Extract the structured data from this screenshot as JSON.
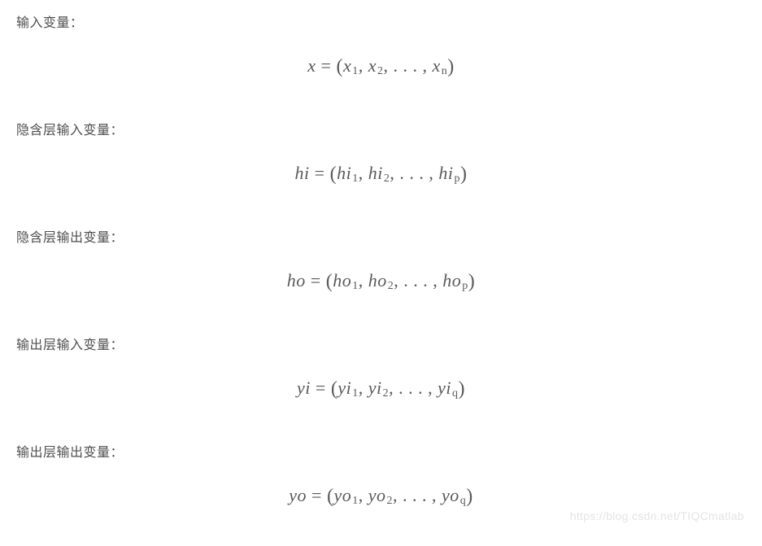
{
  "sections": [
    {
      "label": "输入变量：",
      "lhs": "x",
      "rhs_base": "x",
      "subscript": "n"
    },
    {
      "label": "隐含层输入变量：",
      "lhs": "hi",
      "rhs_base": "hi",
      "subscript": "p"
    },
    {
      "label": "隐含层输出变量：",
      "lhs": "ho",
      "rhs_base": "ho",
      "subscript": "p"
    },
    {
      "label": "输出层输入变量：",
      "lhs": "yi",
      "rhs_base": "yi",
      "subscript": "q"
    },
    {
      "label": "输出层输出变量：",
      "lhs": "yo",
      "rhs_base": "yo",
      "subscript": "q"
    }
  ],
  "watermark": "https://blog.csdn.net/TIQCmatlab",
  "f1_label": "输入变量：",
  "f2_label": "隐含层输入变量：",
  "f3_label": "隐含层输出变量：",
  "f4_label": "输出层输入变量：",
  "f5_label": "输出层输出变量：",
  "f1_lhs": "x",
  "f1_b": "x",
  "f1_s": "n",
  "f2_lhs": "hi",
  "f2_b": "hi",
  "f2_s": "p",
  "f3_lhs": "ho",
  "f3_b": "ho",
  "f3_s": "p",
  "f4_lhs": "yi",
  "f4_b": "yi",
  "f4_s": "q",
  "f5_lhs": "yo",
  "f5_b": "yo",
  "f5_s": "q",
  "eq": " = ",
  "comma": ", ",
  "dots": ". . . ",
  "sub1": "1",
  "sub2": "2"
}
